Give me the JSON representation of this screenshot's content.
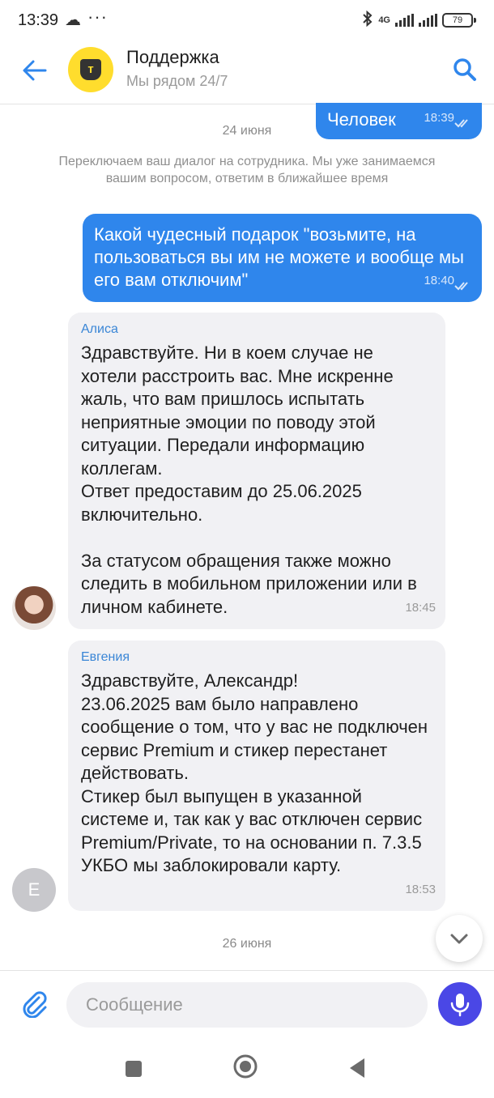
{
  "status_bar": {
    "time": "13:39",
    "dots": "···",
    "network": "4G",
    "battery": "79"
  },
  "header": {
    "logo_letter": "т",
    "title": "Поддержка",
    "subtitle": "Мы рядом 24/7"
  },
  "chat": {
    "first_date": "24 июня",
    "messages": [
      {
        "type": "outgoing",
        "text": "Человек",
        "time": "18:39"
      },
      {
        "type": "system",
        "text": "Переключаем ваш диалог на сотрудника. Мы уже занимаемся вашим вопросом, ответим в ближайшее время"
      },
      {
        "type": "outgoing",
        "text": "Какой чудесный подарок \"возьмите, на пользоваться вы им не можете и вообще мы его вам отключим\"",
        "time": "18:40"
      },
      {
        "type": "incoming",
        "sender": "Алиса",
        "text": "Здравствуйте. Ни в коем случае не хотели расстроить вас. Мне искренне жаль, что вам пришлось испытать неприятные эмоции по поводу этой ситуации. Передали информацию коллегам.\nОтвет предоставим до 25.06.2025 включительно.\n\nЗа статусом обращения также можно следить в мобильном приложении или в личном кабинете.",
        "time": "18:45"
      },
      {
        "type": "incoming",
        "sender": "Евгения",
        "avatar_letter": "Е",
        "text": "Здравствуйте, Александр!\n23.06.2025 вам было направлено сообщение о том, что у вас не подключен сервис Premium и стикер перестанет действовать.\nСтикер был выпущен в указанной системе и, так как у вас отключен сервис Premium/Private, то на основании п. 7.3.5 УКБО мы заблокировали карту.",
        "time": "18:53"
      }
    ],
    "second_date": "26 июня"
  },
  "composer": {
    "placeholder": "Сообщение"
  },
  "colors": {
    "accent": "#2f86ec",
    "bank_yellow": "#ffdd2d",
    "mic_button": "#4a47e6",
    "incoming_bubble": "#f1f1f4"
  },
  "icons": [
    "cloud-icon",
    "bluetooth-icon",
    "signal-icon",
    "battery-icon",
    "back-arrow-icon",
    "search-icon",
    "double-check-icon",
    "chevron-down-icon",
    "paperclip-icon",
    "microphone-icon",
    "nav-recents-icon",
    "nav-home-icon",
    "nav-back-icon"
  ]
}
